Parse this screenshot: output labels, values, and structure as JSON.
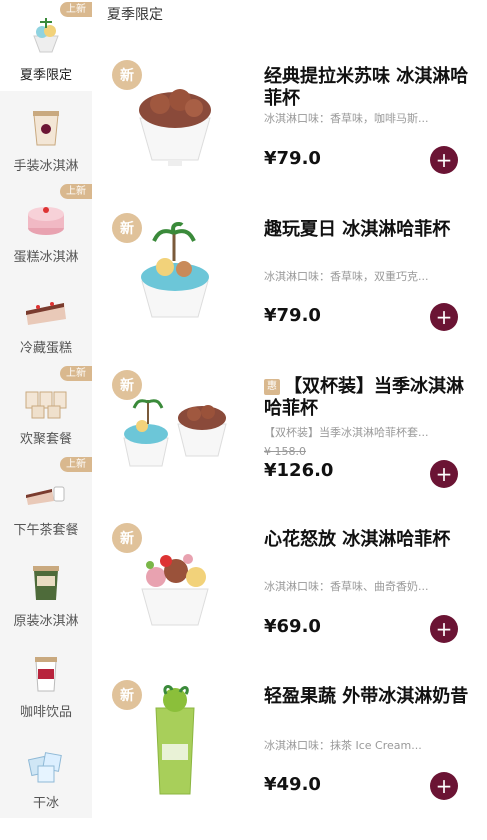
{
  "section_title": "夏季限定",
  "sidebar": {
    "new_label": "上新",
    "items": [
      {
        "label": "夏季限定"
      },
      {
        "label": "手装冰淇淋"
      },
      {
        "label": "蛋糕冰淇淋"
      },
      {
        "label": "冷藏蛋糕"
      },
      {
        "label": "欢聚套餐"
      },
      {
        "label": "下午茶套餐"
      },
      {
        "label": "原装冰淇淋"
      },
      {
        "label": "咖啡饮品"
      },
      {
        "label": "干冰"
      }
    ]
  },
  "badge_new": "新",
  "products": [
    {
      "name": "经典提拉米苏味 冰淇淋哈菲杯",
      "desc": "冰淇淋口味：香草味，咖啡马斯...",
      "price": "¥79.0"
    },
    {
      "name": "趣玩夏日 冰淇淋哈菲杯",
      "desc": "冰淇淋口味：香草味，双重巧克...",
      "price": "¥79.0"
    },
    {
      "tag": "惠",
      "name": "【双杯装】当季冰淇淋哈菲杯",
      "desc": "【双杯装】当季冰淇淋哈菲杯套...",
      "old_price": "¥ 158.0",
      "price": "¥126.0"
    },
    {
      "name": "心花怒放 冰淇淋哈菲杯",
      "desc": "冰淇淋口味：香草味、曲奇香奶...",
      "price": "¥69.0"
    },
    {
      "name": "轻盈果蔬 外带冰淇淋奶昔",
      "desc": "冰淇淋口味：抹茶 Ice Cream...",
      "price": "¥49.0"
    }
  ],
  "add_label": "+"
}
